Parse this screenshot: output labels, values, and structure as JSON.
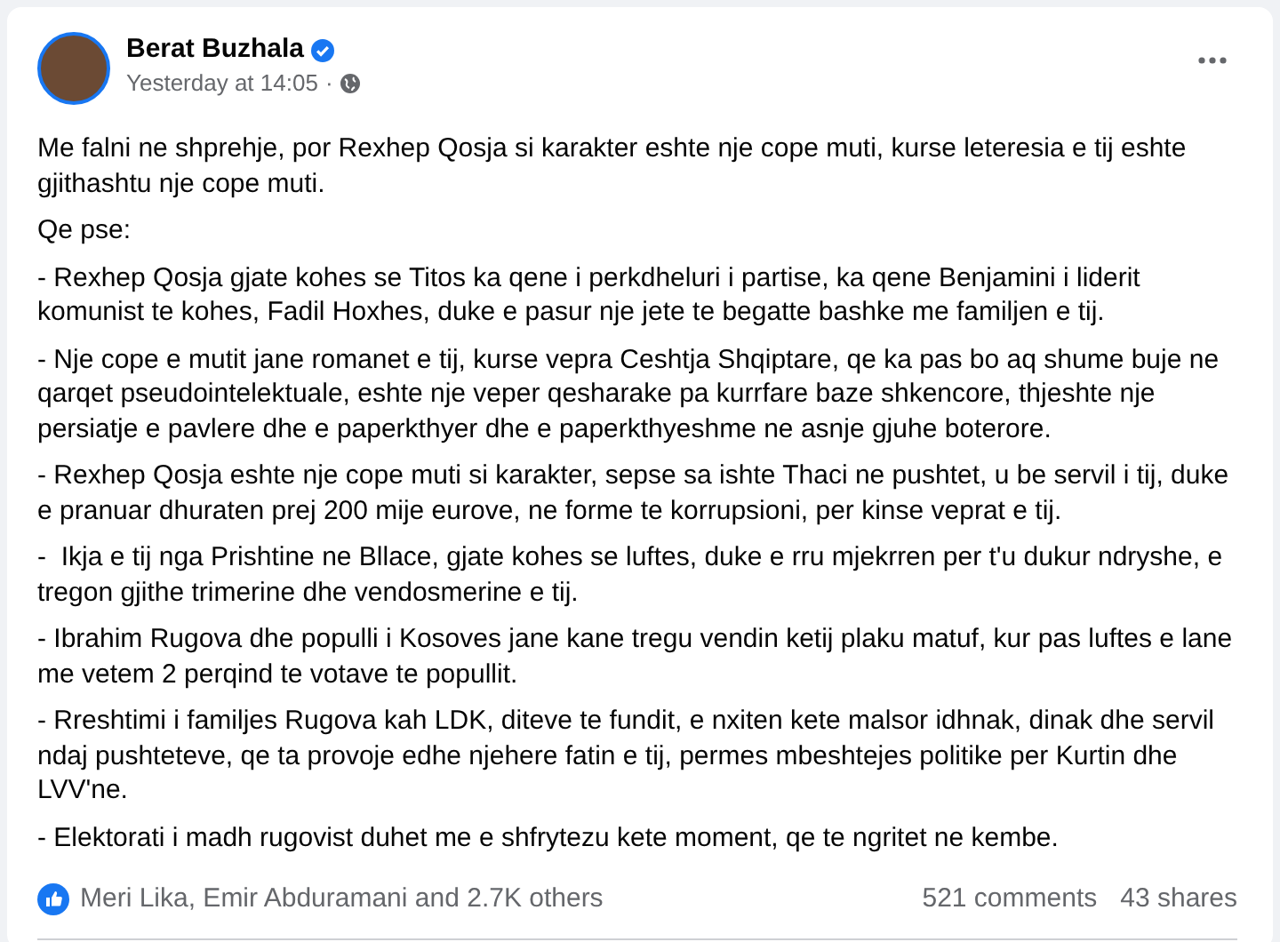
{
  "post": {
    "author": "Berat Buzhala",
    "verified": true,
    "timestamp": "Yesterday at 14:05",
    "separator": "·",
    "paragraphs": [
      "Me falni ne shprehje, por Rexhep Qosja si karakter eshte nje cope muti, kurse leteresia e tij eshte gjithashtu nje cope muti.",
      "Qe pse:",
      "- Rexhep Qosja gjate kohes se Titos ka qene i perkdheluri i partise, ka qene Benjamini i liderit komunist te kohes, Fadil Hoxhes, duke e pasur nje jete te begatte bashke me familjen e tij.",
      "- Nje cope e mutit jane romanet e tij, kurse vepra Ceshtja Shqiptare, qe ka pas bo aq shume buje ne qarqet pseudointelektuale, eshte nje veper qesharake pa kurrfare baze shkencore, thjeshte nje persiatje e pavlere dhe e paperkthyer dhe e paperkthyeshme ne asnje gjuhe boterore.",
      "- Rexhep Qosja eshte nje cope muti si karakter, sepse sa ishte Thaci ne pushtet, u be servil i tij, duke e pranuar dhuraten prej 200 mije eurove, ne forme te korrupsioni, per kinse veprat e tij.",
      "-  Ikja e tij nga Prishtine ne Bllace, gjate kohes se luftes, duke e rru mjekrren per t'u dukur ndryshe, e tregon gjithe trimerine dhe vendosmerine e tij.",
      "- Ibrahim Rugova dhe populli i Kosoves jane kane tregu vendin ketij plaku matuf, kur pas luftes e lane me vetem 2 perqind te votave te popullit.",
      "- Rreshtimi i familjes Rugova kah LDK, diteve te fundit, e nxiten kete malsor idhnak, dinak dhe servil ndaj pushteteve, qe ta provoje edhe njehere fatin e tij, permes mbeshtejes politike per Kurtin dhe LVV'ne.",
      "- Elektorati i madh rugovist duhet me e shfrytezu kete moment, qe te ngritet ne kembe."
    ],
    "reactions": "Meri Lika, Emir Abduramani and 2.7K others",
    "comments": "521 comments",
    "shares": "43 shares"
  }
}
